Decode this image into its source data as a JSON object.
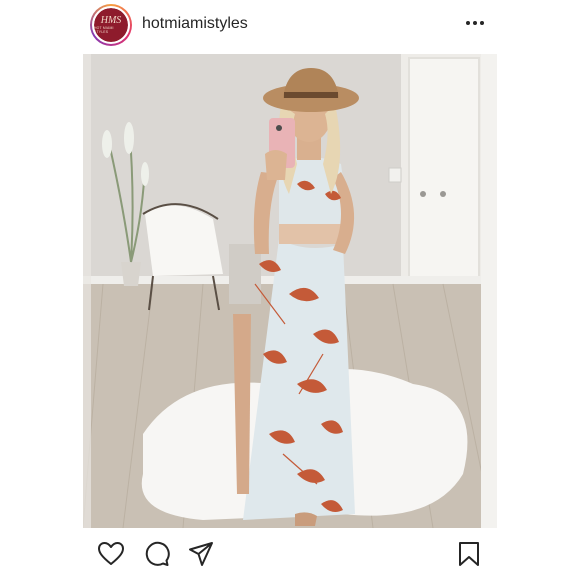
{
  "post": {
    "username": "hotmiamistyles",
    "avatar": {
      "monogram": "HMS",
      "text": "Hot Miami Styles",
      "color": "#8e1b2c"
    },
    "photo": {
      "description_icon": "photo"
    }
  },
  "icons": {
    "more": "more-horizontal-icon",
    "like": "heart-icon",
    "comment": "comment-icon",
    "share": "send-icon",
    "save": "bookmark-icon"
  },
  "colors": {
    "text": "#262626",
    "icon": "#262626"
  }
}
